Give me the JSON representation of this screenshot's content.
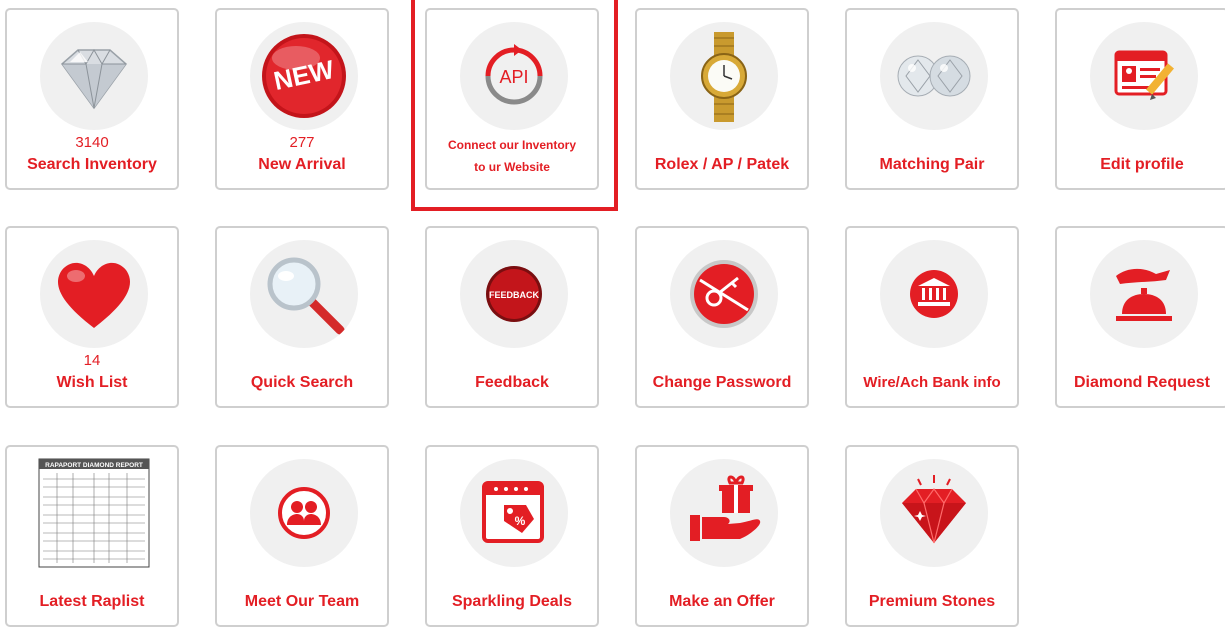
{
  "accent_color": "#e31e24",
  "tiles": [
    {
      "name": "search-inventory",
      "icon": "diamond-icon",
      "count": "3140",
      "label": "Search Inventory"
    },
    {
      "name": "new-arrival",
      "icon": "new-badge-icon",
      "count": "277",
      "label": "New Arrival"
    },
    {
      "name": "api-connect",
      "icon": "api-sync-icon",
      "label_line1": "Connect our Inventory",
      "label_line2": "to ur Website"
    },
    {
      "name": "rolex-ap-patek",
      "icon": "watch-icon",
      "label": "Rolex / AP / Patek"
    },
    {
      "name": "matching-pair",
      "icon": "diamond-pair-icon",
      "label": "Matching Pair"
    },
    {
      "name": "edit-profile",
      "icon": "profile-card-icon",
      "label": "Edit profile"
    },
    {
      "name": "wish-list",
      "icon": "heart-icon",
      "count": "14",
      "label": "Wish List"
    },
    {
      "name": "quick-search",
      "icon": "magnifier-icon",
      "label": "Quick Search"
    },
    {
      "name": "feedback",
      "icon": "feedback-button-icon",
      "icon_text": "FEEDBACK",
      "label": "Feedback"
    },
    {
      "name": "change-password",
      "icon": "key-icon",
      "label": "Change Password"
    },
    {
      "name": "wire-ach-bank-info",
      "icon": "bank-icon",
      "label": "Wire/Ach Bank info"
    },
    {
      "name": "diamond-request",
      "icon": "service-bell-icon",
      "label": "Diamond Request"
    },
    {
      "name": "latest-raplist",
      "icon": "rapaport-report-icon",
      "icon_text": "RAPAPORT DIAMOND REPORT",
      "label": "Latest Raplist"
    },
    {
      "name": "meet-our-team",
      "icon": "team-icon",
      "label": "Meet Our Team"
    },
    {
      "name": "sparkling-deals",
      "icon": "deal-tag-icon",
      "label": "Sparkling Deals"
    },
    {
      "name": "make-an-offer",
      "icon": "gift-hand-icon",
      "label": "Make an Offer"
    },
    {
      "name": "premium-stones",
      "icon": "ruby-icon",
      "label": "Premium Stones"
    }
  ]
}
